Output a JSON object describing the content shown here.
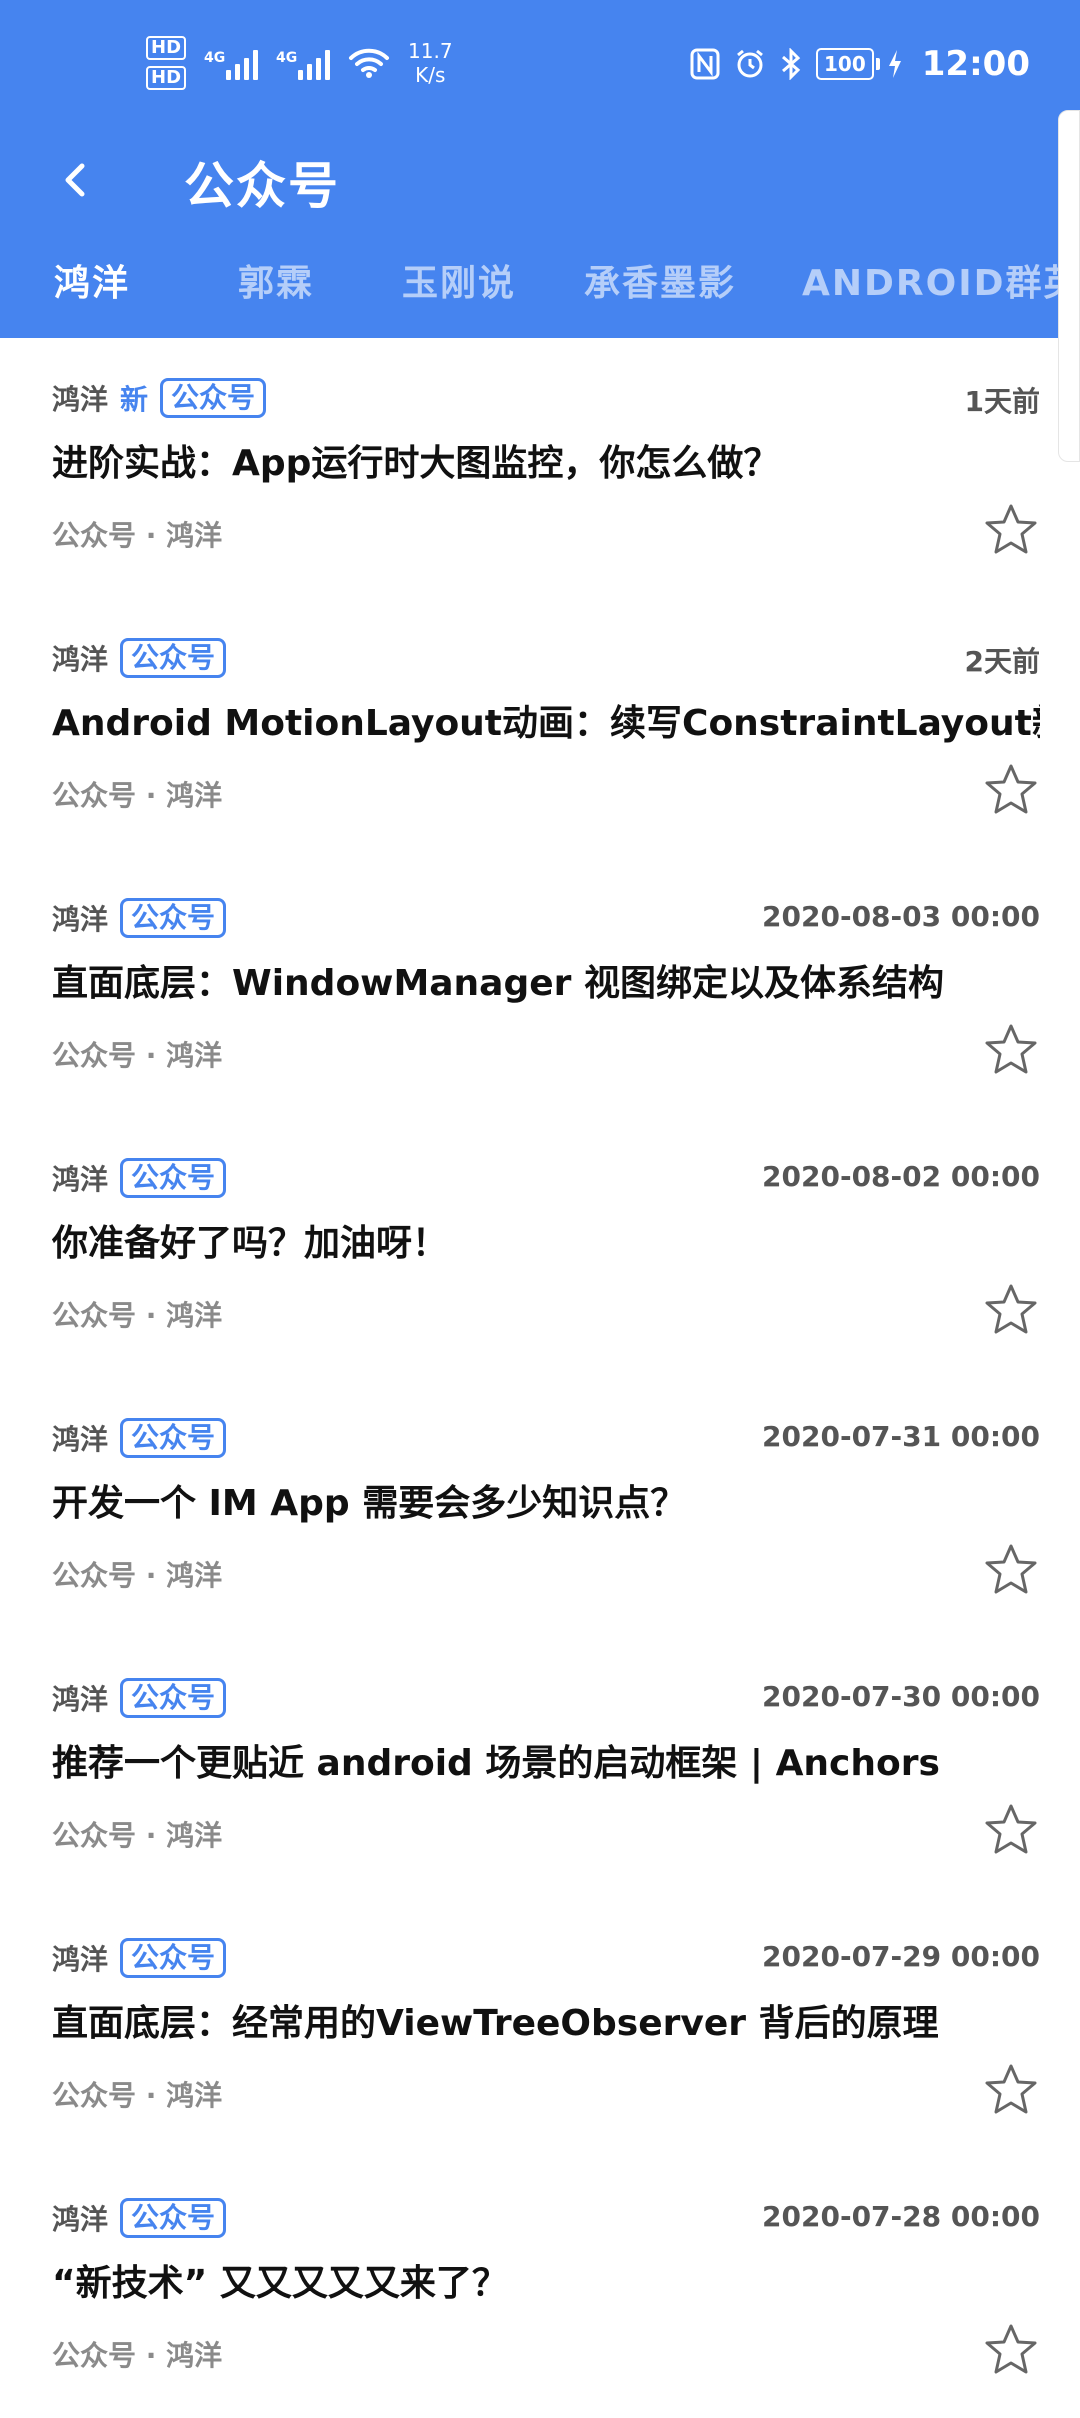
{
  "status_bar": {
    "hd1": "HD",
    "hd2": "HD",
    "net1": "4G",
    "net2": "4G",
    "speed_value": "11.7",
    "speed_unit": "K/s",
    "battery": "100",
    "time": "12:00",
    "icons": [
      "nfc-icon",
      "alarm-icon",
      "bluetooth-icon",
      "battery-icon",
      "charging-icon"
    ]
  },
  "toolbar": {
    "title": "公众号",
    "back_icon": "back-arrow-icon"
  },
  "tabs": [
    {
      "label": "鸿洋",
      "active": true
    },
    {
      "label": "郭霖",
      "active": false
    },
    {
      "label": "玉刚说",
      "active": false
    },
    {
      "label": "承香墨影",
      "active": false
    },
    {
      "label": "ANDROID群英传",
      "active": false
    }
  ],
  "articles": [
    {
      "author": "鸿洋",
      "new_badge": "新",
      "tag": "公众号",
      "time": "1天前",
      "title": "进阶实战：App运行时大图监控，你怎么做？",
      "subtitle": "公众号 · 鸿洋"
    },
    {
      "author": "鸿洋",
      "tag": "公众号",
      "time": "2天前",
      "title": "Android MotionLayout动画：续写ConstraintLayout新篇章",
      "subtitle": "公众号 · 鸿洋"
    },
    {
      "author": "鸿洋",
      "tag": "公众号",
      "time": "2020-08-03 00:00",
      "title": "直面底层：WindowManager 视图绑定以及体系结构",
      "subtitle": "公众号 · 鸿洋"
    },
    {
      "author": "鸿洋",
      "tag": "公众号",
      "time": "2020-08-02 00:00",
      "title": "你准备好了吗？加油呀！",
      "subtitle": "公众号 · 鸿洋"
    },
    {
      "author": "鸿洋",
      "tag": "公众号",
      "time": "2020-07-31 00:00",
      "title": "开发一个 IM App 需要会多少知识点？",
      "subtitle": "公众号 · 鸿洋"
    },
    {
      "author": "鸿洋",
      "tag": "公众号",
      "time": "2020-07-30 00:00",
      "title": "推荐一个更贴近 android 场景的启动框架 | Anchors",
      "subtitle": "公众号 · 鸿洋"
    },
    {
      "author": "鸿洋",
      "tag": "公众号",
      "time": "2020-07-29 00:00",
      "title": "直面底层：经常用的ViewTreeObserver 背后的原理",
      "subtitle": "公众号 · 鸿洋"
    },
    {
      "author": "鸿洋",
      "tag": "公众号",
      "time": "2020-07-28 00:00",
      "title": "“新技术” 又又又又又来了？",
      "subtitle": "公众号 · 鸿洋"
    }
  ],
  "colors": {
    "accent": "#4684EF",
    "text_primary": "#111111",
    "text_secondary": "#8a8a8a"
  }
}
